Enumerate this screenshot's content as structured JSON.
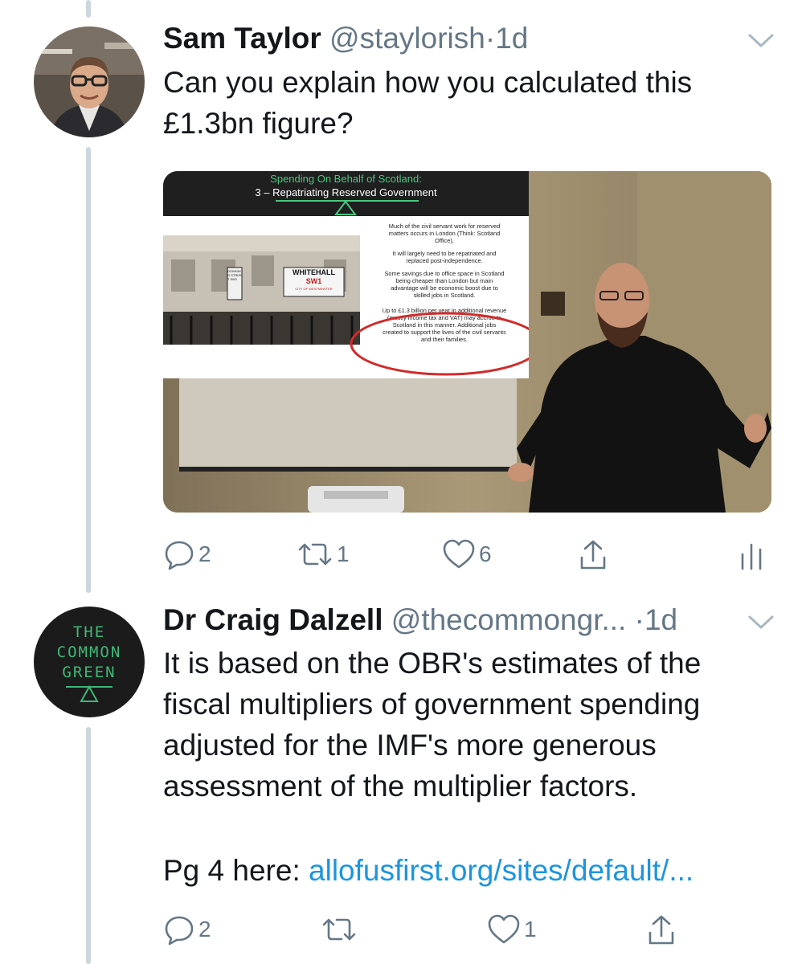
{
  "tweets": [
    {
      "name": "Sam Taylor",
      "handle": "@staylorish",
      "dot": "·",
      "time": "1d",
      "text_lines": [
        "Can you explain how you calculated this",
        "£1.3bn figure?"
      ],
      "media": {
        "slide_title_1": "Spending On Behalf of Scotland:",
        "slide_title_2": "3 – Repatriating Reserved Government",
        "sign_line_1": "WHITEHALL",
        "sign_line_2": "SW1",
        "sign_line_3": "CITY OF WESTMINSTER",
        "sign_side": "DOWNING STREET SW1",
        "bullets": [
          [
            "Much of the civil servant work for reserved",
            "matters occurs in London (Think: Scotland",
            "Office)."
          ],
          [
            "It will largely need to be repatriated and",
            "replaced post-independence."
          ],
          [
            "Some savings due to office space in Scotland",
            "being cheaper than London but main",
            "advantage will be economic boost due to",
            "skilled jobs in Scotland."
          ],
          [
            "Up to £1.3 billion per year in additional revenue",
            "(mostly income tax and VAT) may accrue to",
            "Scotland in this manner. Additional jobs",
            "created to support the lives of the civil servants",
            "and their families."
          ]
        ]
      },
      "replies": "2",
      "retweets": "1",
      "likes": "6"
    },
    {
      "name": "Dr Craig Dalzell",
      "handle": "@thecommongr...",
      "dot": "·",
      "time": "1d",
      "avatar_lines": [
        "THE",
        "COMMON",
        "GREEN"
      ],
      "text_lines": [
        "It is based on the OBR's estimates of the",
        "fiscal multipliers of government spending",
        "adjusted for the IMF's more generous",
        "assessment of the multiplier factors."
      ],
      "link_prefix": "Pg 4 here: ",
      "link_text": "allofusfirst.org/sites/default/...",
      "replies": "2",
      "retweets": "",
      "likes": "1"
    }
  ],
  "colors": {
    "text": "#14171a",
    "secondary": "#657786",
    "link": "#1b95e0",
    "thread": "#ccd6dd",
    "brand_green": "#3fb877"
  }
}
